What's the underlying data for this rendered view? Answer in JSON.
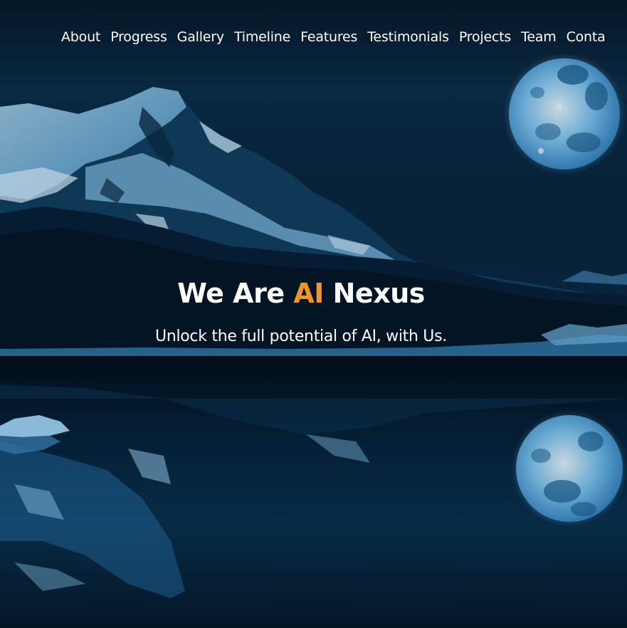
{
  "nav": {
    "items": [
      "About",
      "Progress",
      "Gallery",
      "Timeline",
      "Features",
      "Testimonials",
      "Projects",
      "Team",
      "Conta"
    ]
  },
  "hero": {
    "headline_prefix": "We Are ",
    "headline_accent": "AI",
    "headline_suffix": " Nexus",
    "tagline": "Unlock the full potential of AI, with Us."
  },
  "colors": {
    "accent": "#f7941d",
    "text": "#ffffff",
    "sky": "#0b2f4a"
  }
}
